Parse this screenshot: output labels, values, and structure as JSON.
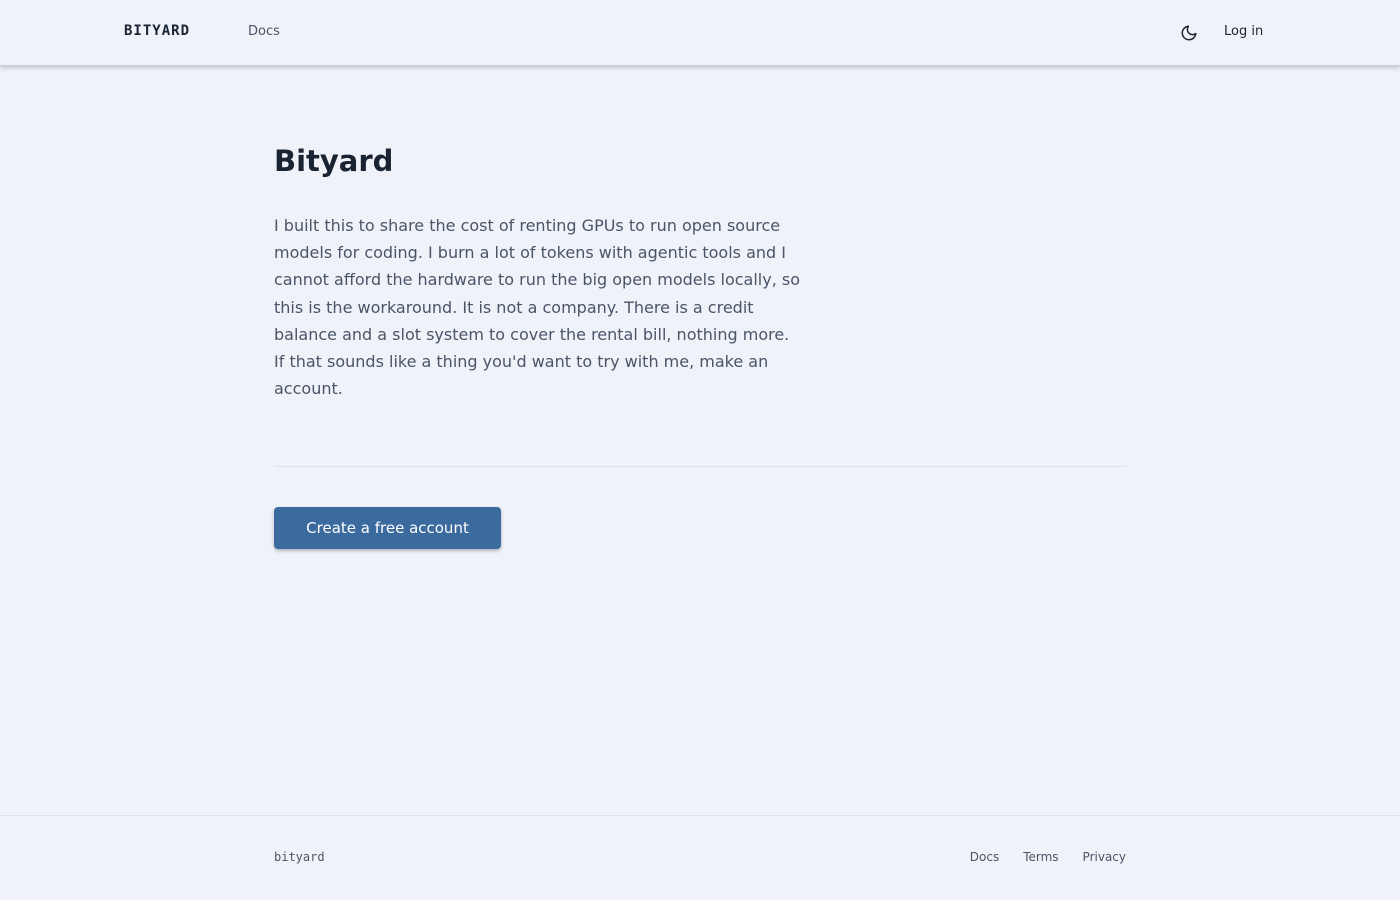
{
  "header": {
    "brand": "BITYARD",
    "nav_docs": "Docs",
    "theme_toggle_icon": "moon-icon",
    "login_label": "Log in"
  },
  "main": {
    "title": "Bityard",
    "intro": "I built this to share the cost of renting GPUs to run open source models for coding. I burn a lot of tokens with agentic tools and I cannot afford the hardware to run the big open models locally, so this is the workaround. It is not a company. There is a credit balance and a slot system to cover the rental bill, nothing more. If that sounds like a thing you'd want to try with me, make an account.",
    "cta_label": "Create a free account"
  },
  "footer": {
    "brand": "bityard",
    "links": [
      "Docs",
      "Terms",
      "Privacy"
    ]
  },
  "colors": {
    "background": "#eff2f8",
    "accent": "#3a6a9e",
    "text": "#1a2332",
    "muted": "#4a5568"
  }
}
